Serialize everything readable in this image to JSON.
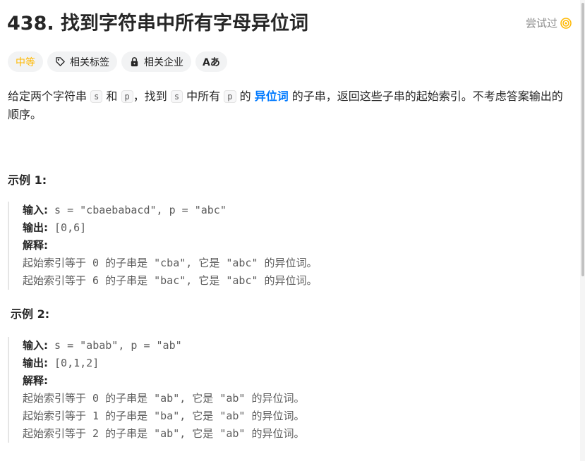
{
  "problem": {
    "title": "438. 找到字符串中所有字母异位词",
    "attempted_label": "尝试过",
    "difficulty": "中等",
    "tags_label": "相关标签",
    "companies_label": "相关企业",
    "translate_label": "Aあ"
  },
  "description": {
    "part1": "给定两个字符串 ",
    "code_s": "s",
    "part2": " 和 ",
    "code_p": "p",
    "part3": "，找到 ",
    "code_s2": "s",
    "part4": " 中所有 ",
    "code_p2": "p",
    "part5": " 的 ",
    "keyword": "异位词",
    "part6": " 的子串，返回这些子串的起始索引。不考虑答案输出的顺序。"
  },
  "examples": [
    {
      "heading": "示例 1:",
      "input_label": "输入:",
      "input_value": " s = \"cbaebabacd\", p = \"abc\"",
      "output_label": "输出:",
      "output_value": " [0,6]",
      "explanation_label": "解释:",
      "explanation_lines": [
        "起始索引等于 0 的子串是 \"cba\", 它是 \"abc\" 的异位词。",
        "起始索引等于 6 的子串是 \"bac\", 它是 \"abc\" 的异位词。"
      ]
    },
    {
      "heading": "示例 2:",
      "input_label": "输入:",
      "input_value": " s = \"abab\", p = \"ab\"",
      "output_label": "输出:",
      "output_value": " [0,1,2]",
      "explanation_label": "解释:",
      "explanation_lines": [
        "起始索引等于 0 的子串是 \"ab\", 它是 \"ab\" 的异位词。",
        "起始索引等于 1 的子串是 \"ba\", 它是 \"ab\" 的异位词。",
        "起始索引等于 2 的子串是 \"ab\", 它是 \"ab\" 的异位词。"
      ]
    }
  ],
  "colors": {
    "difficulty_medium": "#ffb800",
    "keyword_link": "#007aff",
    "attempted_icon": "#ffb800"
  }
}
